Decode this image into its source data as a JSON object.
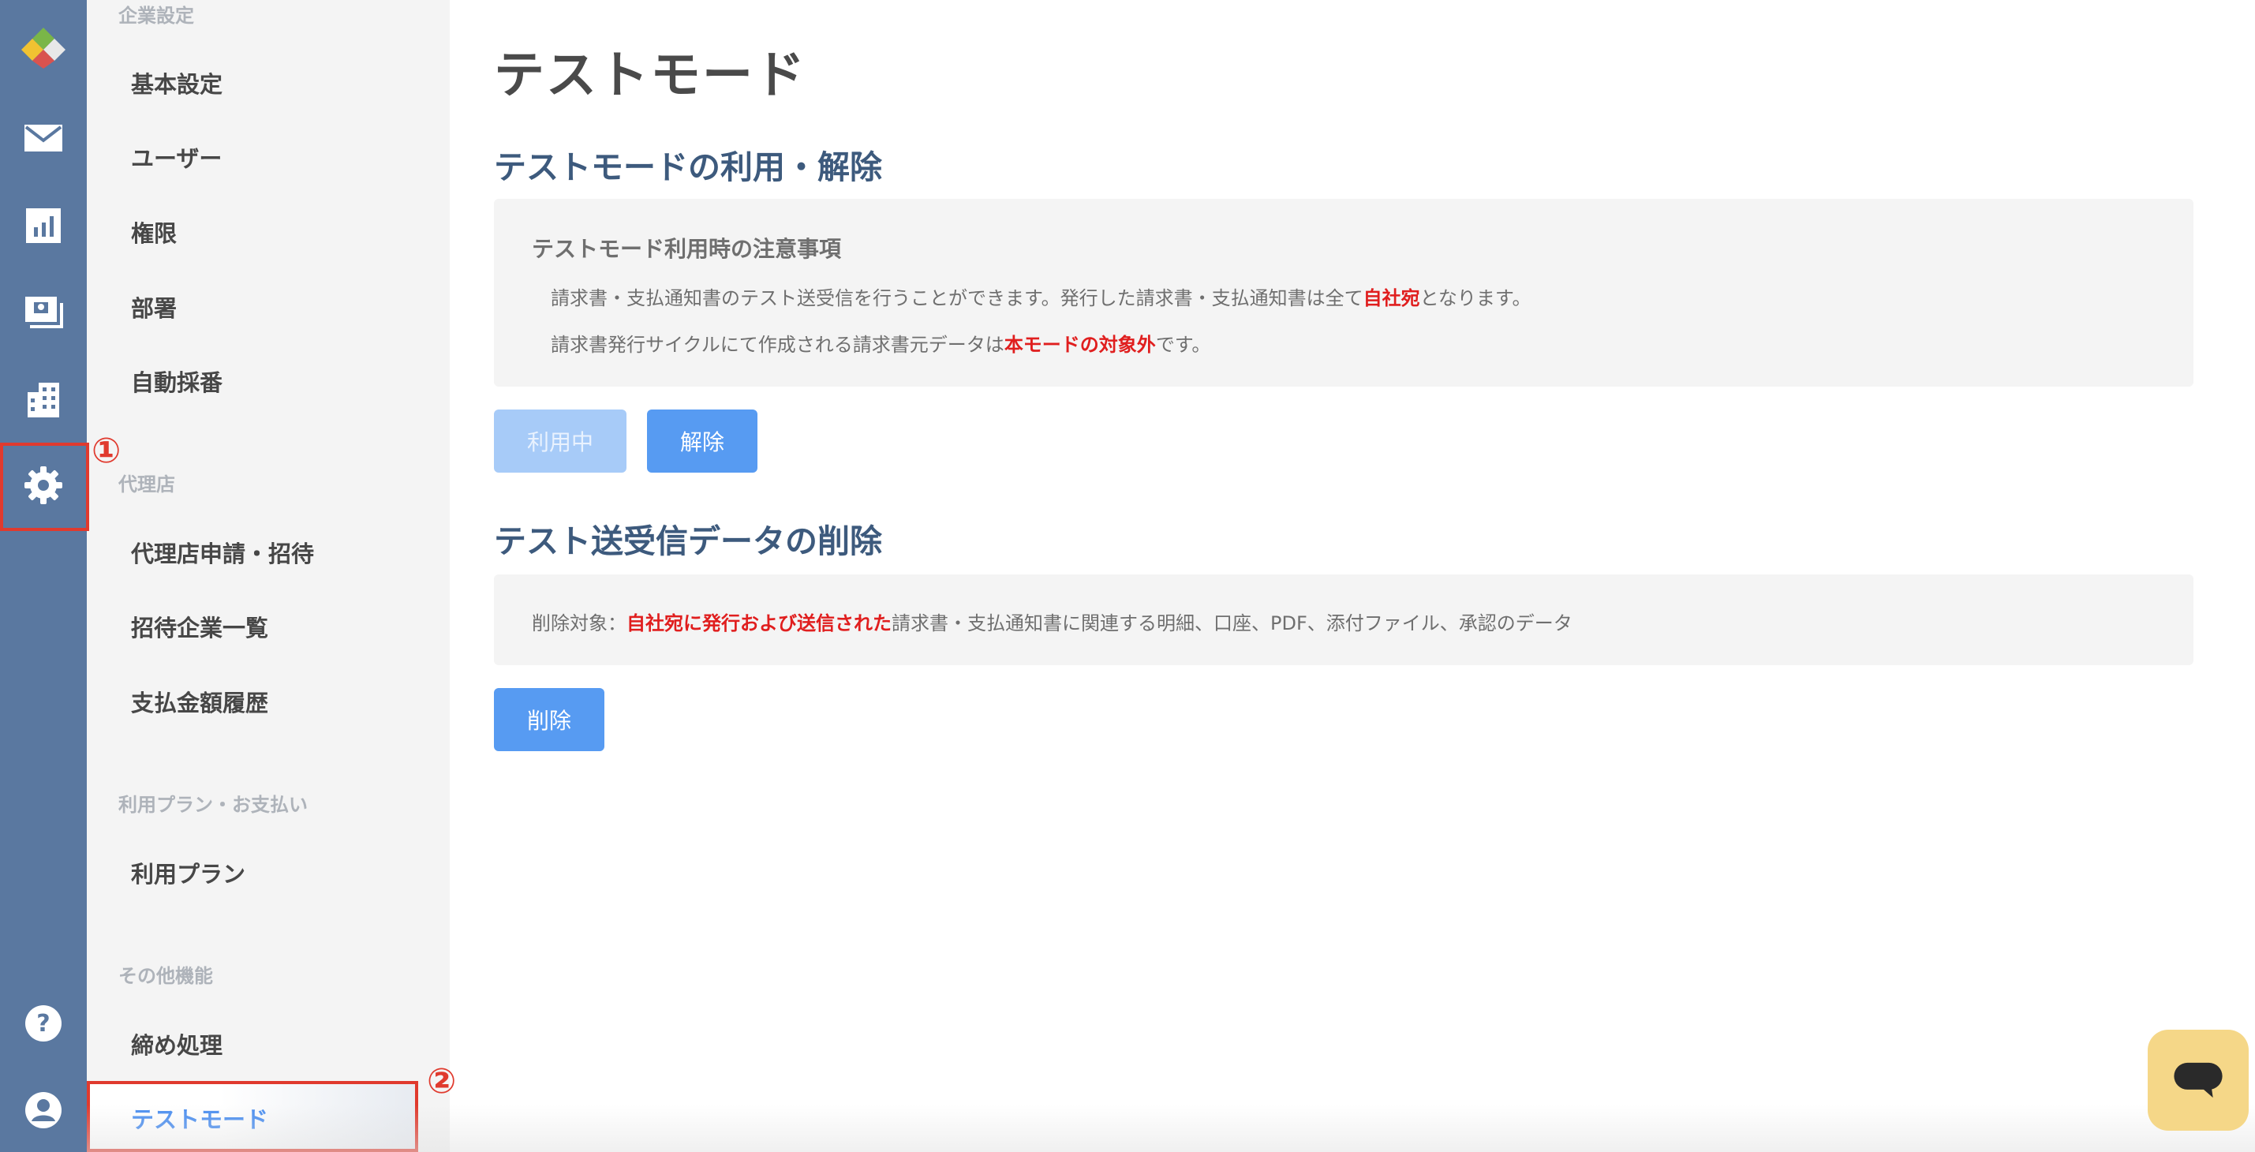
{
  "rail": {
    "icons": [
      "app-logo-icon",
      "mail-icon",
      "chart-icon",
      "invoice-icon",
      "building-icon",
      "gear-icon",
      "help-icon",
      "account-icon"
    ]
  },
  "sidebar": {
    "sections": [
      {
        "heading": "企業設定",
        "items": [
          "基本設定",
          "ユーザー",
          "権限",
          "部署",
          "自動採番"
        ]
      },
      {
        "heading": "代理店",
        "items": [
          "代理店申請・招待",
          "招待企業一覧",
          "支払金額履歴"
        ]
      },
      {
        "heading": "利用プラン・お支払い",
        "items": [
          "利用プラン"
        ]
      },
      {
        "heading": "その他機能",
        "items": [
          "締め処理",
          "テストモード"
        ]
      }
    ],
    "active_item": "テストモード"
  },
  "main": {
    "title": "テストモード",
    "usage_section": {
      "title": "テストモードの利用・解除",
      "notice_title": "テストモード利用時の注意事項",
      "line1_a": "請求書・支払通知書のテスト送受信を行うことができます。発行した請求書・支払通知書は全て",
      "line1_highlight": "自社宛",
      "line1_b": "となります。",
      "line2_a": "請求書発行サイクルにて作成される請求書元データは",
      "line2_highlight": "本モードの対象外",
      "line2_b": "です。",
      "in_use_button": "利用中",
      "release_button": "解除"
    },
    "delete_section": {
      "title": "テスト送受信データの削除",
      "line_a": "削除対象：",
      "line_highlight": "自社宛に発行および送信された",
      "line_b": "請求書・支払通知書に関連する明細、口座、PDF、添付ファイル、承認のデータ",
      "delete_button": "削除"
    }
  },
  "annotations": {
    "mark1": "①",
    "mark2": "②"
  },
  "colors": {
    "rail": "#5a78a0",
    "accent": "#579bf2",
    "highlight": "#e01e1e",
    "annotation": "#e03a2e"
  }
}
